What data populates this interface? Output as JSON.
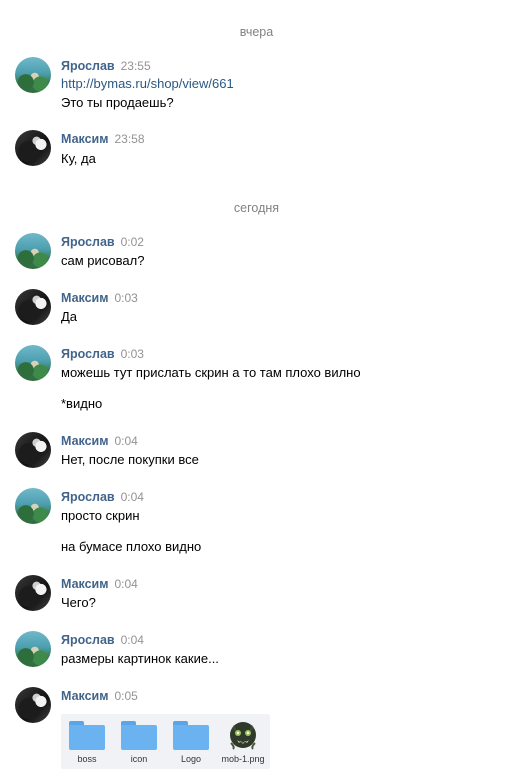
{
  "dividers": {
    "yesterday": "вчера",
    "today": "сегодня"
  },
  "messages": [
    {
      "author": "Ярослав",
      "time": "23:55",
      "lines": [
        "http://bymas.ru/shop/view/661",
        "Это ты продаешь?"
      ]
    },
    {
      "author": "Максим",
      "time": "23:58",
      "lines": [
        "Ку, да"
      ]
    },
    {
      "author": "Ярослав",
      "time": "0:02",
      "lines": [
        "сам рисовал?"
      ]
    },
    {
      "author": "Максим",
      "time": "0:03",
      "lines": [
        "Да"
      ]
    },
    {
      "author": "Ярослав",
      "time": "0:03",
      "lines": [
        "можешь тут прислать скрин а то там плохо вилно",
        "*видно"
      ]
    },
    {
      "author": "Максим",
      "time": "0:04",
      "lines": [
        "Нет, после покупки все"
      ]
    },
    {
      "author": "Ярослав",
      "time": "0:04",
      "lines": [
        "просто скрин",
        "на бумасе плохо видно"
      ]
    },
    {
      "author": "Максим",
      "time": "0:04",
      "lines": [
        "Чего?"
      ]
    },
    {
      "author": "Ярослав",
      "time": "0:04",
      "lines": [
        "размеры картинок какие..."
      ]
    },
    {
      "author": "Максим",
      "time": "0:05",
      "lines": []
    }
  ],
  "attachments": [
    {
      "name": "boss",
      "icon": "folder-icon"
    },
    {
      "name": "icon",
      "icon": "folder-icon"
    },
    {
      "name": "Logo",
      "icon": "folder-icon"
    },
    {
      "name": "mob-1.png",
      "icon": "image-thumbnail-icon"
    }
  ],
  "colors": {
    "author_name": "#42648b",
    "link": "#2a5885",
    "timestamp": "#939393",
    "folder": "#6bb2f0"
  }
}
